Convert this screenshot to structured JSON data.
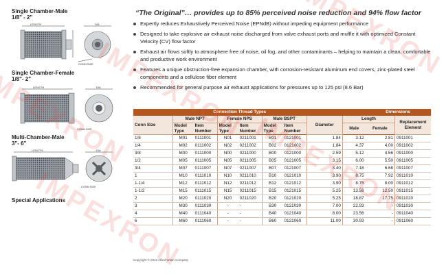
{
  "left": {
    "sections": [
      {
        "title": "Single Chamber-Male",
        "range": "1/8\" - 2\""
      },
      {
        "title": "Single Chamber-Female",
        "range": "1/8\"- 2\""
      },
      {
        "title": "Multi-Chamber-Male",
        "range": "3\"- 6\""
      },
      {
        "title": "Special Applications",
        "range": ""
      }
    ],
    "dims": {
      "length": "LENGTH",
      "dia": "DIA",
      "conn": "CONN SIZE"
    }
  },
  "headline": "“The Original”… provides up to 85% perceived noise reduction and 94% flow factor",
  "bullets": [
    "Expertly reduces Exhaustively Perceived Noise (EPNdB) without impeding equipment performance",
    "Designed to take explosive air exhaust noise discharged from valve exhaust ports and muffle it with optimized Constant Velocity (CV) flow factor",
    "Exhaust air flows softly to atmosphere free of noise, oil fog, and other contaminants – helping to maintain a clean, comfortable and productive work environment",
    "Features a unique obstruction-free expansion chamber, with corrosion-resistant aluminum end covers, zinc-plated steel components and a cellulose fiber element",
    "Recommended for general purpose air exhaust applications for pressures up to 125 psi (8.6 Bar)"
  ],
  "table": {
    "group_connection": "Connection Thread Types",
    "group_dimensions": "Dimensions",
    "conn_size": "Conn Size",
    "male_npt": "Male NPT",
    "female_nps": "Female NPS",
    "male_bspt": "Male BSPT",
    "diameter": "Diameter",
    "length": "Length",
    "replacement": "Replacement Element",
    "model_type": "Model Type",
    "item_number": "Item Number",
    "male": "Male",
    "female": "Female",
    "rows": [
      [
        "1/8",
        "M01",
        "0111001",
        "N01",
        "0211001",
        "B01",
        "0121001",
        "1.84",
        "3.12",
        "2.81",
        "0911001"
      ],
      [
        "1/4",
        "M02",
        "0111002",
        "N02",
        "0211002",
        "B02",
        "0121002",
        "1.84",
        "4.37",
        "4.00",
        "0911002"
      ],
      [
        "3/8",
        "M00",
        "0111000",
        "N00",
        "0211000",
        "B00",
        "0121000",
        "2.59",
        "5.12",
        "4.56",
        "0911000"
      ],
      [
        "1/2",
        "M05",
        "0111005",
        "N05",
        "0211005",
        "B05",
        "0121005",
        "3.15",
        "6.00",
        "5.50",
        "0911005"
      ],
      [
        "3/4",
        "M07",
        "0111007",
        "N07",
        "0211007",
        "B07",
        "0121007",
        "3.40",
        "7.18",
        "6.68",
        "0911007"
      ],
      [
        "1",
        "M10",
        "0111010",
        "N10",
        "0211010",
        "B10",
        "0121010",
        "3.90",
        "8.75",
        "7.92",
        "0911010"
      ],
      [
        "1-1/4",
        "M12",
        "0111012",
        "N12",
        "0211012",
        "B12",
        "0121012",
        "3.90",
        "8.75",
        "8.00",
        "0911012"
      ],
      [
        "1-1/2",
        "M15",
        "0111015",
        "N15",
        "0211015",
        "B15",
        "0121015",
        "5.25",
        "13.56",
        "12.50",
        "0911015"
      ],
      [
        "2",
        "M20",
        "0111020",
        "N20",
        "0211020",
        "B20",
        "0121020",
        "5.25",
        "18.87",
        "17.75",
        "0911020"
      ],
      [
        "3",
        "M30",
        "0111030",
        "-",
        "-",
        "B30",
        "0121030",
        "7.00",
        "22.93",
        "-",
        "0911030"
      ],
      [
        "4",
        "M40",
        "0111040",
        "-",
        "-",
        "B40",
        "0121040",
        "8.00",
        "23.56",
        "-",
        "0911040"
      ],
      [
        "6",
        "M60",
        "0111060",
        "-",
        "-",
        "B60",
        "0121060",
        "11.00",
        "30.93",
        "-",
        "0911060"
      ]
    ]
  },
  "copyright": "Copyright © 2010 Allied Witan Company",
  "watermark": "IMPEXRON",
  "colors": {
    "header": "#b4571f",
    "subheader": "#f3e6dc"
  }
}
